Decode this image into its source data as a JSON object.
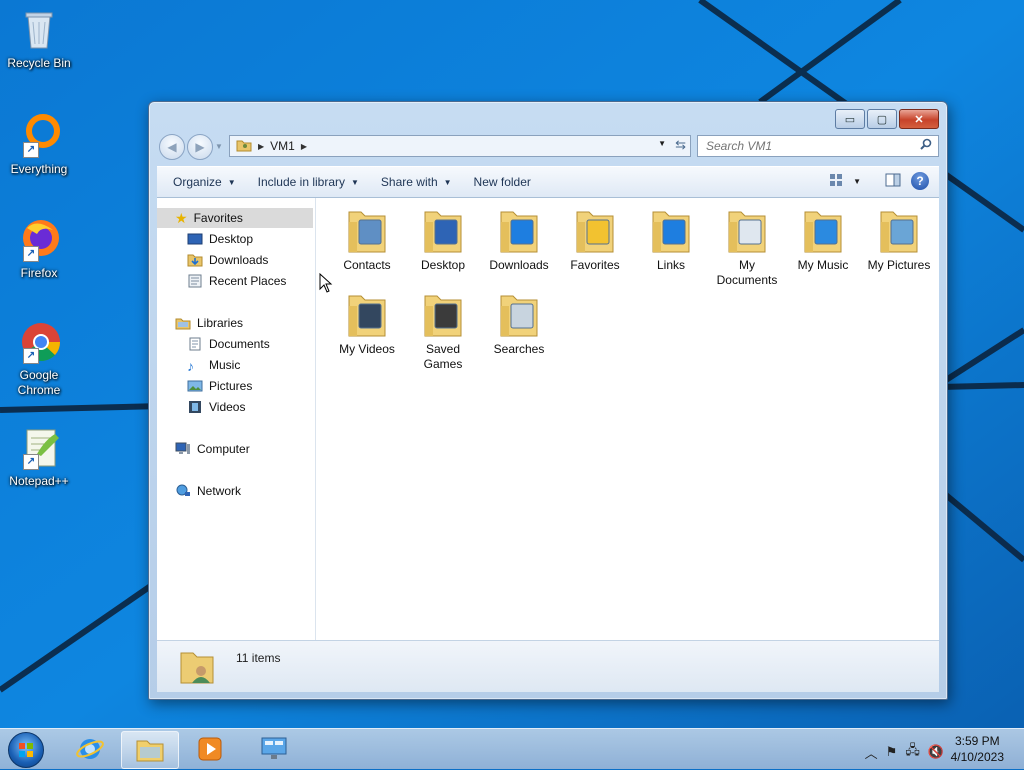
{
  "desktop": {
    "icons": [
      {
        "label": "Recycle Bin"
      },
      {
        "label": "Everything"
      },
      {
        "label": "Firefox"
      },
      {
        "label": "Google Chrome"
      },
      {
        "label": "Notepad++"
      }
    ]
  },
  "window": {
    "controls": {
      "minimize": "▭",
      "maximize": "▢",
      "close": "✕"
    },
    "address": {
      "path": [
        "VM1"
      ]
    },
    "search": {
      "placeholder": "Search VM1"
    },
    "commands": [
      "Organize",
      "Include in library",
      "Share with",
      "New folder"
    ],
    "nav_pane": {
      "favorites": {
        "label": "Favorites",
        "items": [
          "Desktop",
          "Downloads",
          "Recent Places"
        ]
      },
      "libraries": {
        "label": "Libraries",
        "items": [
          "Documents",
          "Music",
          "Pictures",
          "Videos"
        ]
      },
      "computer": {
        "label": "Computer"
      },
      "network": {
        "label": "Network"
      }
    },
    "files": [
      {
        "name": "Contacts",
        "icon": "contacts-folder-icon"
      },
      {
        "name": "Desktop",
        "icon": "desktop-folder-icon"
      },
      {
        "name": "Downloads",
        "icon": "downloads-folder-icon"
      },
      {
        "name": "Favorites",
        "icon": "favorites-folder-icon"
      },
      {
        "name": "Links",
        "icon": "links-folder-icon"
      },
      {
        "name": "My Documents",
        "icon": "documents-folder-icon"
      },
      {
        "name": "My Music",
        "icon": "music-folder-icon"
      },
      {
        "name": "My Pictures",
        "icon": "pictures-folder-icon"
      },
      {
        "name": "My Videos",
        "icon": "videos-folder-icon"
      },
      {
        "name": "Saved Games",
        "icon": "saved-games-folder-icon"
      },
      {
        "name": "Searches",
        "icon": "searches-folder-icon"
      }
    ],
    "status": {
      "count": "11 items"
    }
  },
  "taskbar": {
    "clock": {
      "time": "3:59 PM",
      "date": "4/10/2023"
    }
  },
  "colors": {
    "desktop": "#0a6fc7",
    "window_frame": "#c6dcf2",
    "accent": "#1a5fb4"
  }
}
